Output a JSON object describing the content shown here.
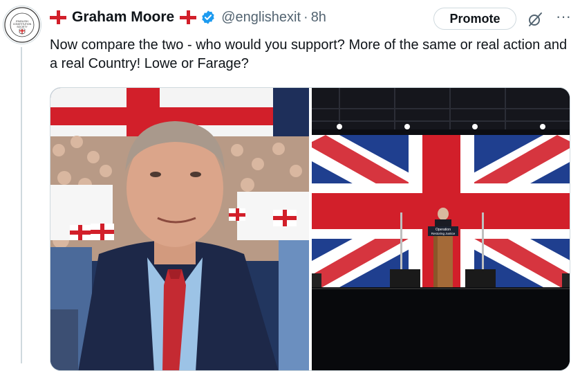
{
  "author": {
    "name": "Graham Moore",
    "handle": "@englishexit",
    "separator": "·",
    "time": "8h",
    "avatar_text": [
      "THE CONSTITUTION",
      "ENGLISH",
      "CONSTITUTION",
      "SOCIETY",
      "IS THE SOLUTION"
    ]
  },
  "actions": {
    "promote_label": "Promote",
    "more_label": "···"
  },
  "tweet": {
    "text": "Now compare the two - who would you support? More of the same or real action and a real Country! Lowe or Farage?"
  },
  "media": {
    "left_image": "man-in-suit-with-crowd-and-st-george-flags",
    "right_image": "speaker-at-podium-with-union-jack-backdrop",
    "podium_sign": [
      "Operation",
      "Restoring Justice"
    ]
  },
  "colors": {
    "flag_red": "#d21f2a",
    "verified_blue": "#1d9bf0",
    "muted": "#536471"
  }
}
